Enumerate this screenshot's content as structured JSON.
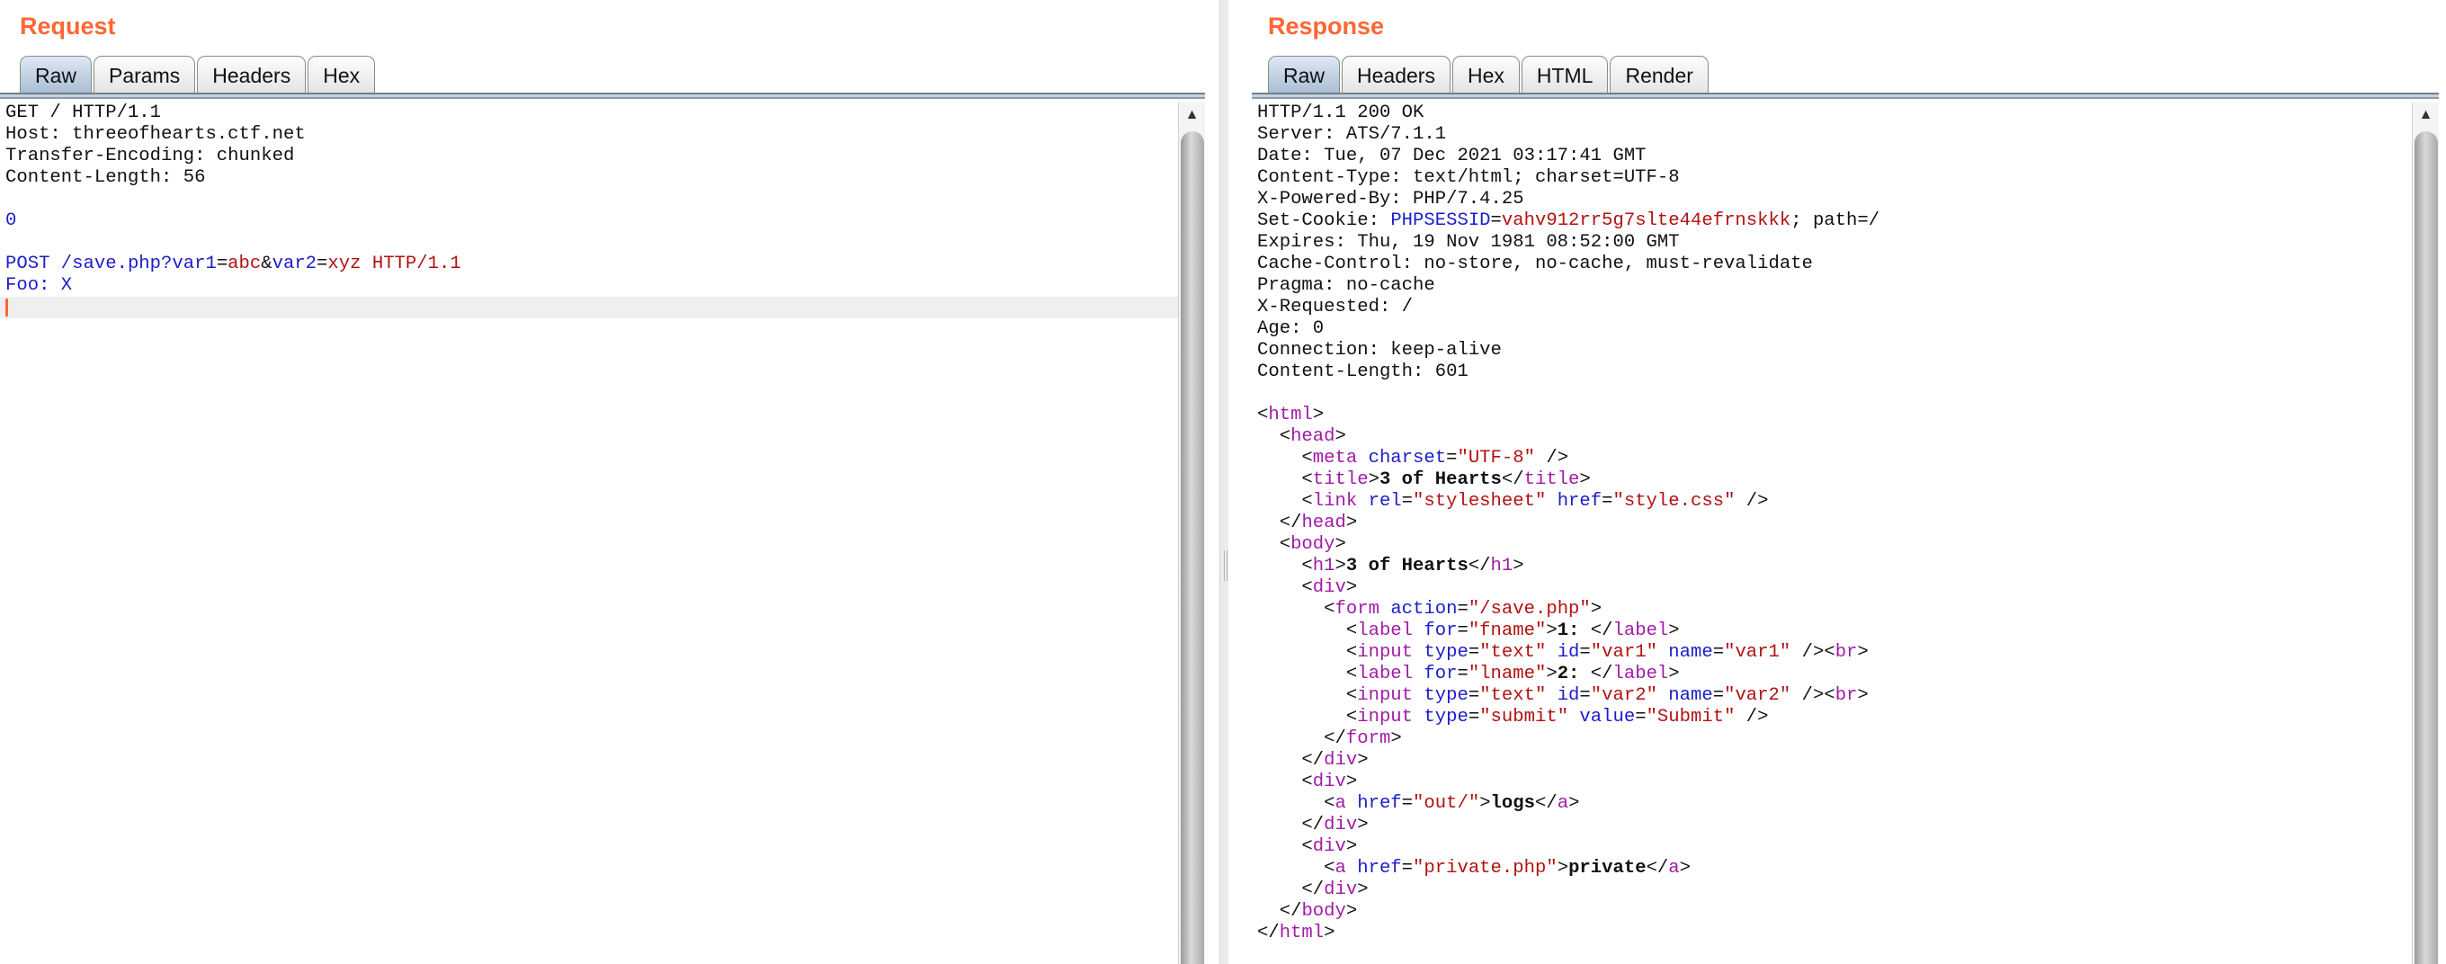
{
  "request": {
    "title": "Request",
    "tabs": [
      "Raw",
      "Params",
      "Headers",
      "Hex"
    ],
    "active_tab": "Raw",
    "lines": [
      [
        {
          "t": "GET / HTTP/1.1"
        }
      ],
      [
        {
          "t": "Host: threeofhearts.ctf.net"
        }
      ],
      [
        {
          "t": "Transfer-Encoding: chunked"
        }
      ],
      [
        {
          "t": "Content-Length: 56"
        }
      ],
      [],
      [
        {
          "t": "0",
          "c": "c-blue"
        }
      ],
      [],
      [
        {
          "t": "POST /save.php?",
          "c": "c-blue"
        },
        {
          "t": "var1",
          "c": "c-blue"
        },
        {
          "t": "=",
          "c": ""
        },
        {
          "t": "abc",
          "c": "c-red"
        },
        {
          "t": "&",
          "c": ""
        },
        {
          "t": "var2",
          "c": "c-blue"
        },
        {
          "t": "=",
          "c": ""
        },
        {
          "t": "xyz HTTP/1.1",
          "c": "c-red"
        }
      ],
      [
        {
          "t": "Foo: X",
          "c": "c-blue"
        }
      ],
      []
    ]
  },
  "response": {
    "title": "Response",
    "tabs": [
      "Raw",
      "Headers",
      "Hex",
      "HTML",
      "Render"
    ],
    "active_tab": "Raw",
    "lines": [
      [
        {
          "t": "HTTP/1.1 200 OK"
        }
      ],
      [
        {
          "t": "Server: ATS/7.1.1"
        }
      ],
      [
        {
          "t": "Date: Tue, 07 Dec 2021 03:17:41 GMT"
        }
      ],
      [
        {
          "t": "Content-Type: text/html; charset=UTF-8"
        }
      ],
      [
        {
          "t": "X-Powered-By: PHP/7.4.25"
        }
      ],
      [
        {
          "t": "Set-Cookie: "
        },
        {
          "t": "PHPSESSID",
          "c": "c-blue"
        },
        {
          "t": "="
        },
        {
          "t": "vahv912rr5g7slte44efrnskkk",
          "c": "c-red"
        },
        {
          "t": "; path=/"
        }
      ],
      [
        {
          "t": "Expires: Thu, 19 Nov 1981 08:52:00 GMT"
        }
      ],
      [
        {
          "t": "Cache-Control: no-store, no-cache, must-revalidate"
        }
      ],
      [
        {
          "t": "Pragma: no-cache"
        }
      ],
      [
        {
          "t": "X-Requested: /"
        }
      ],
      [
        {
          "t": "Age: 0"
        }
      ],
      [
        {
          "t": "Connection: keep-alive"
        }
      ],
      [
        {
          "t": "Content-Length: 601"
        }
      ],
      [],
      [
        {
          "t": "<"
        },
        {
          "t": "html",
          "c": "c-tag"
        },
        {
          "t": ">"
        }
      ],
      [
        {
          "t": "  <"
        },
        {
          "t": "head",
          "c": "c-tag"
        },
        {
          "t": ">"
        }
      ],
      [
        {
          "t": "    <"
        },
        {
          "t": "meta",
          "c": "c-tag"
        },
        {
          "t": " "
        },
        {
          "t": "charset",
          "c": "c-attr"
        },
        {
          "t": "="
        },
        {
          "t": "\"UTF-8\"",
          "c": "c-str"
        },
        {
          "t": " />"
        }
      ],
      [
        {
          "t": "    <"
        },
        {
          "t": "title",
          "c": "c-tag"
        },
        {
          "t": ">"
        },
        {
          "t": "3 of Hearts",
          "c": "c-bold"
        },
        {
          "t": "</"
        },
        {
          "t": "title",
          "c": "c-tag"
        },
        {
          "t": ">"
        }
      ],
      [
        {
          "t": "    <"
        },
        {
          "t": "link",
          "c": "c-tag"
        },
        {
          "t": " "
        },
        {
          "t": "rel",
          "c": "c-attr"
        },
        {
          "t": "="
        },
        {
          "t": "\"stylesheet\"",
          "c": "c-str"
        },
        {
          "t": " "
        },
        {
          "t": "href",
          "c": "c-attr"
        },
        {
          "t": "="
        },
        {
          "t": "\"style.css\"",
          "c": "c-str"
        },
        {
          "t": " />"
        }
      ],
      [
        {
          "t": "  </"
        },
        {
          "t": "head",
          "c": "c-tag"
        },
        {
          "t": ">"
        }
      ],
      [
        {
          "t": "  <"
        },
        {
          "t": "body",
          "c": "c-tag"
        },
        {
          "t": ">"
        }
      ],
      [
        {
          "t": "    <"
        },
        {
          "t": "h1",
          "c": "c-tag"
        },
        {
          "t": ">"
        },
        {
          "t": "3 of Hearts",
          "c": "c-bold"
        },
        {
          "t": "</"
        },
        {
          "t": "h1",
          "c": "c-tag"
        },
        {
          "t": ">"
        }
      ],
      [
        {
          "t": "    <"
        },
        {
          "t": "div",
          "c": "c-tag"
        },
        {
          "t": ">"
        }
      ],
      [
        {
          "t": "      <"
        },
        {
          "t": "form",
          "c": "c-tag"
        },
        {
          "t": " "
        },
        {
          "t": "action",
          "c": "c-attr"
        },
        {
          "t": "="
        },
        {
          "t": "\"/save.php\"",
          "c": "c-str"
        },
        {
          "t": ">"
        }
      ],
      [
        {
          "t": "        <"
        },
        {
          "t": "label",
          "c": "c-tag"
        },
        {
          "t": " "
        },
        {
          "t": "for",
          "c": "c-attr"
        },
        {
          "t": "="
        },
        {
          "t": "\"fname\"",
          "c": "c-str"
        },
        {
          "t": ">"
        },
        {
          "t": "1:",
          "c": "c-bold"
        },
        {
          "t": " </"
        },
        {
          "t": "label",
          "c": "c-tag"
        },
        {
          "t": ">"
        }
      ],
      [
        {
          "t": "        <"
        },
        {
          "t": "input",
          "c": "c-tag"
        },
        {
          "t": " "
        },
        {
          "t": "type",
          "c": "c-attr"
        },
        {
          "t": "="
        },
        {
          "t": "\"text\"",
          "c": "c-str"
        },
        {
          "t": " "
        },
        {
          "t": "id",
          "c": "c-attr"
        },
        {
          "t": "="
        },
        {
          "t": "\"var1\"",
          "c": "c-str"
        },
        {
          "t": " "
        },
        {
          "t": "name",
          "c": "c-attr"
        },
        {
          "t": "="
        },
        {
          "t": "\"var1\"",
          "c": "c-str"
        },
        {
          "t": " /><"
        },
        {
          "t": "br",
          "c": "c-tag"
        },
        {
          "t": ">"
        }
      ],
      [
        {
          "t": "        <"
        },
        {
          "t": "label",
          "c": "c-tag"
        },
        {
          "t": " "
        },
        {
          "t": "for",
          "c": "c-attr"
        },
        {
          "t": "="
        },
        {
          "t": "\"lname\"",
          "c": "c-str"
        },
        {
          "t": ">"
        },
        {
          "t": "2:",
          "c": "c-bold"
        },
        {
          "t": " </"
        },
        {
          "t": "label",
          "c": "c-tag"
        },
        {
          "t": ">"
        }
      ],
      [
        {
          "t": "        <"
        },
        {
          "t": "input",
          "c": "c-tag"
        },
        {
          "t": " "
        },
        {
          "t": "type",
          "c": "c-attr"
        },
        {
          "t": "="
        },
        {
          "t": "\"text\"",
          "c": "c-str"
        },
        {
          "t": " "
        },
        {
          "t": "id",
          "c": "c-attr"
        },
        {
          "t": "="
        },
        {
          "t": "\"var2\"",
          "c": "c-str"
        },
        {
          "t": " "
        },
        {
          "t": "name",
          "c": "c-attr"
        },
        {
          "t": "="
        },
        {
          "t": "\"var2\"",
          "c": "c-str"
        },
        {
          "t": " /><"
        },
        {
          "t": "br",
          "c": "c-tag"
        },
        {
          "t": ">"
        }
      ],
      [
        {
          "t": "        <"
        },
        {
          "t": "input",
          "c": "c-tag"
        },
        {
          "t": " "
        },
        {
          "t": "type",
          "c": "c-attr"
        },
        {
          "t": "="
        },
        {
          "t": "\"submit\"",
          "c": "c-str"
        },
        {
          "t": " "
        },
        {
          "t": "value",
          "c": "c-attr"
        },
        {
          "t": "="
        },
        {
          "t": "\"Submit\"",
          "c": "c-str"
        },
        {
          "t": " />"
        }
      ],
      [
        {
          "t": "      </"
        },
        {
          "t": "form",
          "c": "c-tag"
        },
        {
          "t": ">"
        }
      ],
      [
        {
          "t": "    </"
        },
        {
          "t": "div",
          "c": "c-tag"
        },
        {
          "t": ">"
        }
      ],
      [
        {
          "t": "    <"
        },
        {
          "t": "div",
          "c": "c-tag"
        },
        {
          "t": ">"
        }
      ],
      [
        {
          "t": "      <"
        },
        {
          "t": "a",
          "c": "c-tag"
        },
        {
          "t": " "
        },
        {
          "t": "href",
          "c": "c-attr"
        },
        {
          "t": "="
        },
        {
          "t": "\"out/\"",
          "c": "c-str"
        },
        {
          "t": ">"
        },
        {
          "t": "logs",
          "c": "c-bold"
        },
        {
          "t": "</"
        },
        {
          "t": "a",
          "c": "c-tag"
        },
        {
          "t": ">"
        }
      ],
      [
        {
          "t": "    </"
        },
        {
          "t": "div",
          "c": "c-tag"
        },
        {
          "t": ">"
        }
      ],
      [
        {
          "t": "    <"
        },
        {
          "t": "div",
          "c": "c-tag"
        },
        {
          "t": ">"
        }
      ],
      [
        {
          "t": "      <"
        },
        {
          "t": "a",
          "c": "c-tag"
        },
        {
          "t": " "
        },
        {
          "t": "href",
          "c": "c-attr"
        },
        {
          "t": "="
        },
        {
          "t": "\"private.php\"",
          "c": "c-str"
        },
        {
          "t": ">"
        },
        {
          "t": "private",
          "c": "c-bold"
        },
        {
          "t": "</"
        },
        {
          "t": "a",
          "c": "c-tag"
        },
        {
          "t": ">"
        }
      ],
      [
        {
          "t": "    </"
        },
        {
          "t": "div",
          "c": "c-tag"
        },
        {
          "t": ">"
        }
      ],
      [
        {
          "t": "  </"
        },
        {
          "t": "body",
          "c": "c-tag"
        },
        {
          "t": ">"
        }
      ],
      [
        {
          "t": "</"
        },
        {
          "t": "html",
          "c": "c-tag"
        },
        {
          "t": ">"
        }
      ]
    ]
  },
  "colors": {
    "title_orange": "#ff6633",
    "caret": "#ff6633",
    "tag_purple": "#a11ba6",
    "attr_blue": "#1c1ccc",
    "string_red": "#b21111"
  },
  "icons": {
    "scroll_up": "up-arrow-icon"
  }
}
